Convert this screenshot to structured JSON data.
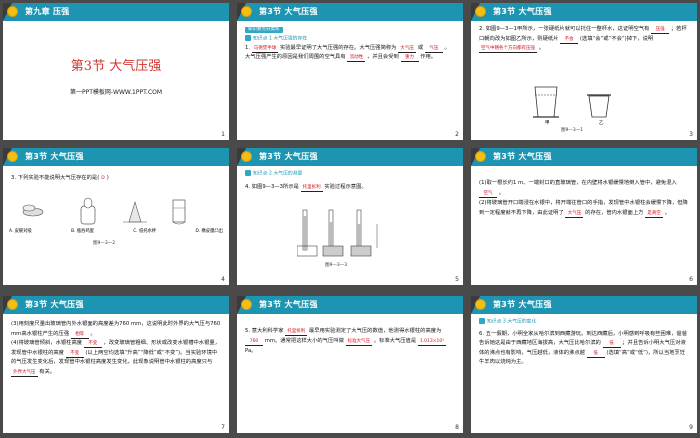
{
  "slides": [
    {
      "header": "第九章  压强",
      "title": "第3节   大气压强",
      "subtitle": "第一PPT模板网-WWW.1PPT.COM",
      "number": "1"
    },
    {
      "header": "第3节    大气压强",
      "banner": "知识要点分类练",
      "kp": "知识点 1  大气压强的存在",
      "q_prefix": "1.",
      "b1": "马德堡半球",
      "t1": "实验最早证明了大气压强的存在。大气压强简称为",
      "b2": "大气压",
      "t2": "或",
      "b3": "气压",
      "t3": "。大气压强产生的原因是我们周围的空气具有",
      "b4": "流动性",
      "t4": "，并且会受到",
      "b5": "重力",
      "t5": "作用。",
      "number": "2"
    },
    {
      "header": "第3节    大气压强",
      "t1": "2. 如图9—3—1甲所示，一张硬纸片就可以托住一整杯水，这证明空气有",
      "b1": "压强",
      "t2": "；若杯口朝向改为如图乙所示，则硬纸片",
      "b2": "不会",
      "t3": "(选填“会”或“不会”)掉下，说明",
      "b3": "空气中朝各个方向都有压强",
      "t4": "。",
      "lab_a": "甲",
      "lab_b": "乙",
      "caption": "图9—3—1",
      "number": "3"
    },
    {
      "header": "第3节    大气压强",
      "q": "3. 下列实验不能说明大气压存在的是(",
      "ans": "D",
      "q_end": ")",
      "opts": [
        "A. 皮碗对吸",
        "B. 瓶吞鸡蛋",
        "C. 纸托水杯",
        "D. 橡皮膜凸出"
      ],
      "caption": "图9—3—2",
      "number": "4"
    },
    {
      "header": "第3节    大气压强",
      "kp": "知识点 2  大气压的测量",
      "t1": "4. 如图9—3—3所示是",
      "b1": "托里拆利",
      "t2": "实验过程示意图。",
      "caption": "图9—3—3",
      "number": "5"
    },
    {
      "header": "第3节    大气压强",
      "p1": "(1)取一根长约1 m、一端封口的直玻璃管，在内壁将水银缓慢地倒入管中，避免混入",
      "b1": "空气",
      "p1e": "。",
      "p2": "(2)将玻璃管开口端浸在水银中，将开端往管口的手指，发现管中水银柱会缓慢下降，但降到一定程度就不再下降，由此证明了",
      "b2": "大气压",
      "p2m": "的存在，管内水银面上方",
      "b3": "是真空",
      "p2e": "。",
      "number": "6"
    },
    {
      "header": "第3节    大气压强",
      "p1": "(3)用刻度尺量出玻璃管内外水银面的高度差为760 mm，这说明此时外界的大气压与760 mm高水银柱产生的压强",
      "b1": "相等",
      "p1e": "。",
      "p2": "(4)将玻璃管倾斜，水银柱高度",
      "b2": "不变",
      "p2m": "，改变玻璃管粗细、形状或改变水银槽中水银量，发现管中水银柱的高度",
      "b3": "不变",
      "p2n": "(以上两空均选填“升高”“降低”或“不变”)。当实验环境中的气压发生变化后，发现管中水银柱高度发生变化，此现象说明管中水银柱的高度只与",
      "b4": "外界大气压",
      "p2e": "有关。",
      "number": "7"
    },
    {
      "header": "第3节    大气压强",
      "t1": "5. 意大利科学家",
      "b1": "托里拆利",
      "t2": "最早用实验测定了大气压的数值，他测得水银柱的高度为",
      "b2": "760",
      "t3": "mm。通常把这样大小的气压叫做",
      "b3": "标准大气压",
      "t4": "。标准大气压值是",
      "b4": "1.013×10⁵",
      "t5": "Pa。",
      "number": "8"
    },
    {
      "header": "第3节    大气压强",
      "kp": "知识点 3  大气压的变化",
      "t1": "6. 五一假期，小明全家从哈尔滨到西藏游玩。到达西藏后，小明感到呼吸有些困难，爸爸告诉她这是由于西藏地区海拔高，大气压比哈尔滨的",
      "b1": "低",
      "t2": "；并且告诉小明大气压对液体的沸点也有影响，气压越低，液体的沸点越",
      "b2": "低",
      "t3": "(选填“高”或“低”)，所以当地烹饪牛羊肉以烧炖为主。",
      "number": "9"
    }
  ]
}
